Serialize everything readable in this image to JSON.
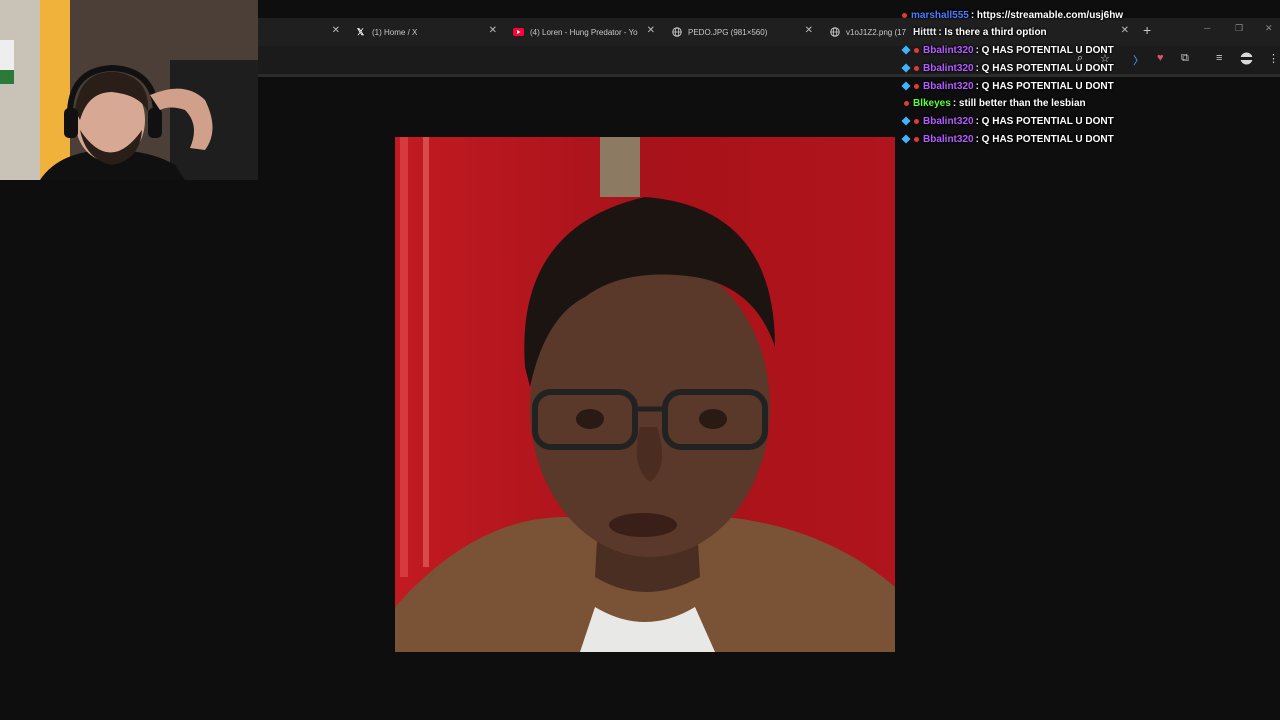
{
  "browser": {
    "tabs": [
      {
        "title": "",
        "icon": "blank-icon"
      },
      {
        "title": "(1) Home / X",
        "icon": "x-logo-icon"
      },
      {
        "title": "(4) Loren - Hung Predator - Yo",
        "icon": "youtube-icon"
      },
      {
        "title": "PEDO.JPG (981×560)",
        "icon": "globe-icon"
      },
      {
        "title": "v1oJ1Z2.png (17",
        "icon": "globe-icon"
      }
    ],
    "new_tab": "+",
    "window_controls": {
      "minimize": "─",
      "maximize": "❐",
      "close": "✕"
    }
  },
  "webcam": {
    "label": "streamer-webcam"
  },
  "chat": {
    "messages": [
      {
        "user": "marshall555",
        "text": ": https://streamable.com/usj6hw",
        "user_color": "#4a7dff",
        "badges": [
          "dot"
        ]
      },
      {
        "user": "Hitttt",
        "text": ": Is there a third option",
        "user_color": "#e8eaed",
        "badges": []
      },
      {
        "user": "Bbalint320",
        "text": ": Q HAS POTENTIAL U DONT",
        "user_color": "#b35cff",
        "badges": [
          "gem",
          "dot"
        ]
      },
      {
        "user": "Bbalint320",
        "text": ": Q HAS POTENTIAL U DONT",
        "user_color": "#b35cff",
        "badges": [
          "gem",
          "dot"
        ]
      },
      {
        "user": "Bbalint320",
        "text": ": Q HAS POTENTIAL U DONT",
        "user_color": "#b35cff",
        "badges": [
          "gem",
          "dot"
        ]
      },
      {
        "user": "Blkeyes",
        "text": ": still better than the lesbian",
        "user_color": "#5cff3a",
        "badges": [
          "dot"
        ]
      },
      {
        "user": "Bbalint320",
        "text": ": Q HAS POTENTIAL U DONT",
        "user_color": "#b35cff",
        "badges": [
          "gem",
          "dot"
        ]
      },
      {
        "user": "Bbalint320",
        "text": ": Q HAS POTENTIAL U DONT",
        "user_color": "#b35cff",
        "badges": [
          "gem",
          "dot"
        ]
      }
    ]
  },
  "colors": {
    "photo_background": "#b5161e",
    "page_background": "#0e0e0e"
  }
}
